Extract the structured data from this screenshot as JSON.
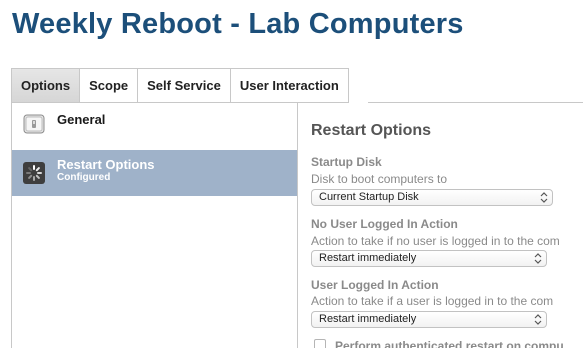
{
  "page": {
    "title": "Weekly Reboot - Lab Computers"
  },
  "tabs": [
    {
      "label": "Options",
      "active": true
    },
    {
      "label": "Scope",
      "active": false
    },
    {
      "label": "Self Service",
      "active": false
    },
    {
      "label": "User Interaction",
      "active": false
    }
  ],
  "sidebar": {
    "items": [
      {
        "label": "General",
        "icon": "switch-icon"
      },
      {
        "label": "Restart Options",
        "sub": "Configured",
        "icon": "spinner-icon",
        "selected": true
      }
    ]
  },
  "main": {
    "title": "Restart Options",
    "startup_disk": {
      "label": "Startup Disk",
      "desc": "Disk to boot computers to",
      "value": "Current Startup Disk"
    },
    "no_user_action": {
      "label": "No User Logged In Action",
      "desc": "Action to take if no user is logged in to the com",
      "value": "Restart immediately"
    },
    "user_action": {
      "label": "User Logged In Action",
      "desc": "Action to take if a user is logged in to the com",
      "value": "Restart immediately"
    },
    "auth_restart": {
      "label": "Perform authenticated restart on compu",
      "checked": false
    }
  },
  "colors": {
    "title": "#1c4f7a",
    "selected_bg": "#9fb2c9",
    "label_gray": "#8a8a8a"
  }
}
